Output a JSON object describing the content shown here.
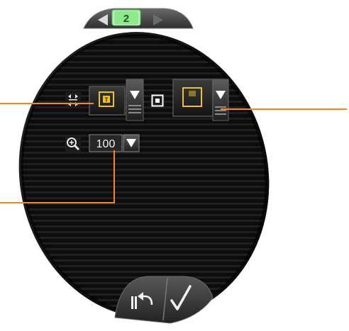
{
  "panel": {
    "page_number": "2",
    "zoom": {
      "value": "100"
    },
    "colors": {
      "accent": "#f0c020",
      "callout": "#f28a1e",
      "tab_active": "#8ee88e",
      "tab_text": "#1a5a1a",
      "panel_dark": "#0c0c0c"
    },
    "icons": {
      "prev": "left-triangle-icon",
      "next": "right-triangle-icon",
      "fit": "fit-to-page-icon",
      "text": "text-frame-icon",
      "frame": "frame-icon",
      "page": "page-icon",
      "zoom": "magnifier-plus-icon",
      "undo": "undo-icon",
      "ok": "checkmark-icon"
    }
  }
}
